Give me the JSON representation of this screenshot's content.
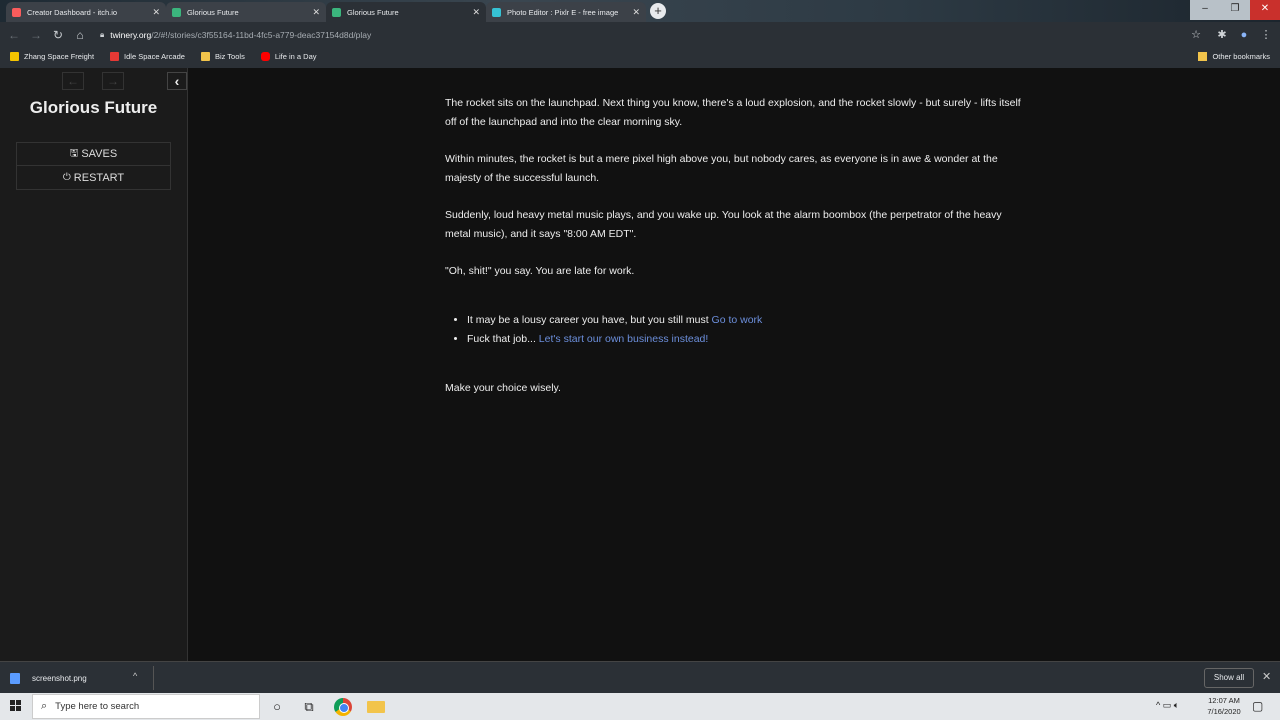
{
  "browser": {
    "tabs": [
      {
        "title": "Creator Dashboard - itch.io",
        "fav_color": "#fa5c5c",
        "active": false
      },
      {
        "title": "Glorious Future",
        "fav_color": "#3bb57d",
        "active": false
      },
      {
        "title": "Glorious Future",
        "fav_color": "#3bb57d",
        "active": true
      },
      {
        "title": "Photo Editor : Pixlr E - free image",
        "fav_color": "#36c2d4",
        "active": false
      }
    ],
    "url_host": "twinery.org",
    "url_path": "/2/#!/stories/c3f55164-11bd-4fc5-a779-deac37154d8d/play",
    "bookmarks": [
      {
        "label": "Zhang Space Freight",
        "color": "#f5c400"
      },
      {
        "label": "Idle Space Arcade",
        "color": "#e53935"
      },
      {
        "label": "Biz Tools",
        "color": "#f2c44b"
      },
      {
        "label": "Life in a Day",
        "color": "#ff0000"
      }
    ],
    "other_bookmarks": "Other bookmarks"
  },
  "sidebar": {
    "title": "Glorious Future",
    "saves_label": "SAVES",
    "restart_label": "RESTART"
  },
  "passage": {
    "p1": "The rocket sits on the launchpad. Next thing you know, there's a loud explosion, and the rocket slowly - but surely - lifts itself off of the launchpad and into the clear morning sky.",
    "p2": "Within minutes, the rocket is but a mere pixel high above you, but nobody cares, as everyone is in awe & wonder at the majesty of the successful launch.",
    "p3": "Suddenly, loud heavy metal music plays, and you wake up. You look at the alarm boombox (the perpetrator of the heavy metal music), and it says \"8:00 AM EDT\".",
    "p4": "\"Oh, shit!\" you say. You are late for work.",
    "choice1_text": "It may be a lousy career you have, but you still must ",
    "choice1_link": "Go to work",
    "choice2_text": "Fuck that job... ",
    "choice2_link": "Let's start our own business instead!",
    "p5": "Make your choice wisely."
  },
  "downloads": {
    "file": "screenshot.png",
    "show_all": "Show all"
  },
  "taskbar": {
    "search_placeholder": "Type here to search",
    "time": "12:07 AM",
    "date": "7/16/2020"
  }
}
